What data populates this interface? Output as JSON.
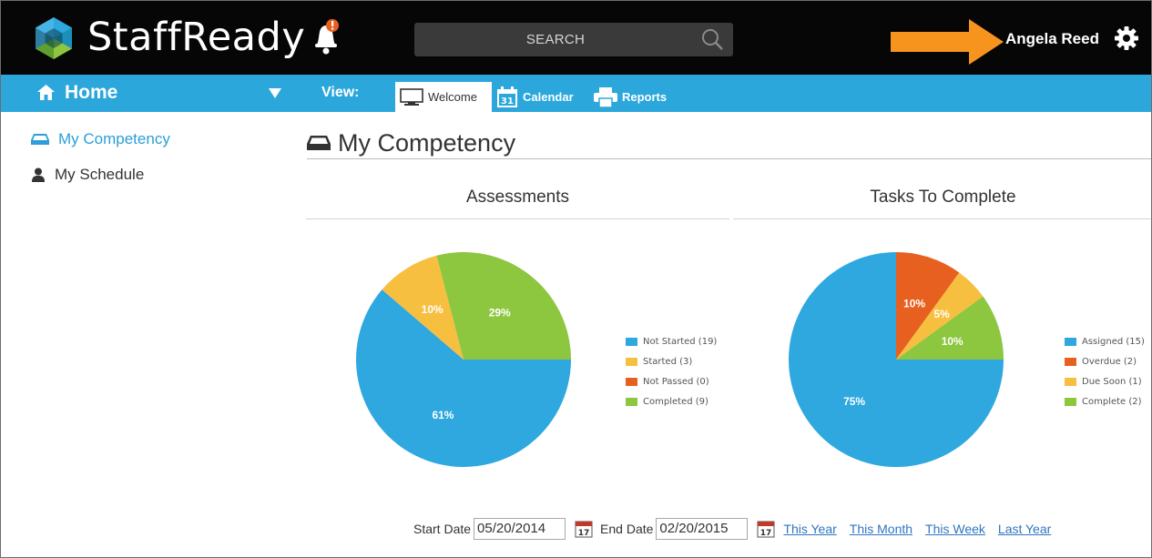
{
  "header": {
    "brand": "StaffReady",
    "search_placeholder": "SEARCH",
    "user_name": "Angela Reed"
  },
  "nav": {
    "home_label": "Home",
    "view_label": "View:",
    "tabs": [
      {
        "label": "Welcome",
        "active": true
      },
      {
        "label": "Calendar",
        "active": false
      },
      {
        "label": "Reports",
        "active": false
      }
    ]
  },
  "sidebar": {
    "items": [
      {
        "label": "My Competency",
        "active": true
      },
      {
        "label": "My Schedule",
        "active": false
      }
    ]
  },
  "main": {
    "title": "My Competency"
  },
  "chart_data": [
    {
      "type": "pie",
      "title": "Assessments",
      "categories": [
        "Not Started (19)",
        "Started (3)",
        "Not Passed (0)",
        "Completed (9)"
      ],
      "values": [
        19,
        3,
        0,
        9
      ],
      "data_labels": [
        "61%",
        "10%",
        "",
        "29%"
      ],
      "colors": [
        "#2ea8df",
        "#f7bf3f",
        "#e8601f",
        "#8dc63f"
      ],
      "legend": "right"
    },
    {
      "type": "pie",
      "title": "Tasks To Complete",
      "categories": [
        "Assigned (15)",
        "Overdue (2)",
        "Due Soon (1)",
        "Complete (2)"
      ],
      "values": [
        15,
        2,
        1,
        2
      ],
      "data_labels": [
        "75%",
        "10%",
        "5%",
        "10%"
      ],
      "colors": [
        "#2ea8df",
        "#e8601f",
        "#f7bf3f",
        "#8dc63f"
      ],
      "legend": "right"
    }
  ],
  "filters": {
    "start_label": "Start Date",
    "start_value": "05/20/2014",
    "end_label": "End Date",
    "end_value": "02/20/2015",
    "calendar_day": "17",
    "links": [
      "This Year",
      "This Month",
      "This Week",
      "Last Year"
    ]
  },
  "colors": {
    "header_bg": "#060606",
    "nav_bg": "#2ba7dc",
    "accent": "#2b9fd7",
    "arrow": "#f7941d",
    "bell_badge": "#e8601f"
  }
}
